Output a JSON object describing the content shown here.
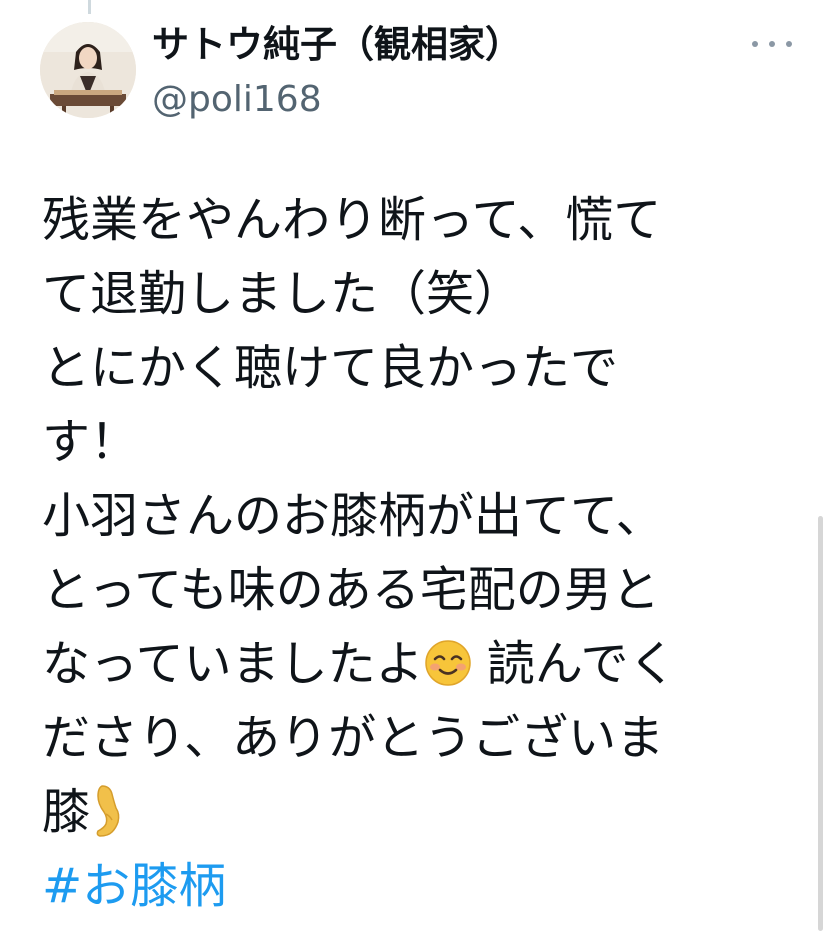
{
  "author": {
    "display_name": "サトウ純子（観相家）",
    "handle": "@poli168",
    "avatar_icon": "profile-photo"
  },
  "menu": {
    "more_icon": "more-options-icon"
  },
  "tweet": {
    "lines": [
      "残業をやんわり断って、慌て",
      "て退勤しました（笑）",
      "とにかく聴けて良かったで",
      "す！",
      "小羽さんのお膝柄が出てて、",
      "とっても味のある宅配の男と"
    ],
    "line7_before": "なっていましたよ",
    "line7_emoji": "smiling-face-icon",
    "line7_after": " 読んでく",
    "line8": "ださり、ありがとうございま",
    "line9_text": "膝",
    "line9_emoji": "leg-icon",
    "hashtag": "#お膝柄"
  },
  "colors": {
    "text": "#0f1419",
    "secondary": "#536471",
    "link": "#1d9bf0"
  }
}
